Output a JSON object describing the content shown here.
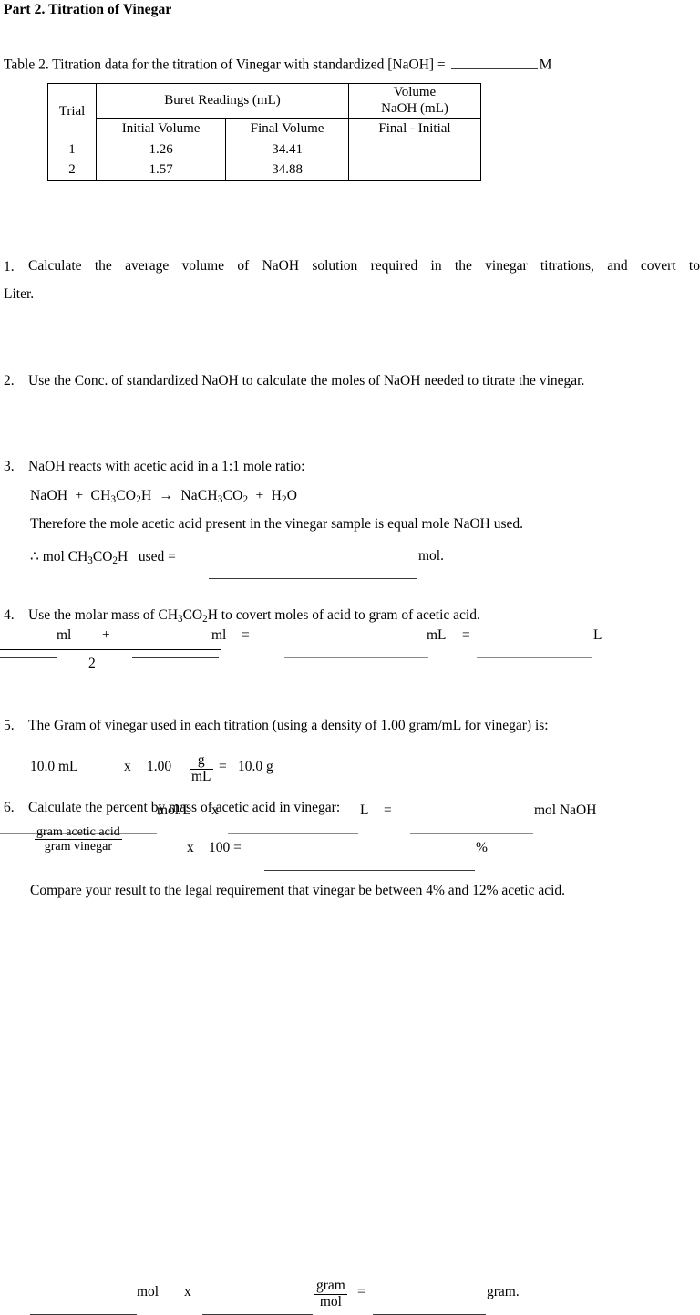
{
  "document": {
    "title": "Part 2.  Titration of Vinegar"
  },
  "table_section": {
    "caption_prefix": "Table 2.   Titration data for the titration of Vinegar with standardized [NaOH] =",
    "caption_unit": "M",
    "table": {
      "header_row": {
        "trial": "Trial",
        "buret": "Buret Readings (mL)",
        "volume_line1": "Volume",
        "volume_line2": "NaOH (mL)"
      },
      "subheader_row": {
        "trial": "",
        "initial": "Initial Volume",
        "final": "Final Volume",
        "difference": "Final - Initial"
      },
      "rows": [
        {
          "trial": "1",
          "initial": "1.26",
          "final": "34.41",
          "volume": ""
        },
        {
          "trial": "2",
          "initial": "1.57",
          "final": "34.88",
          "volume": ""
        }
      ]
    }
  },
  "questions": [
    {
      "number": "1.",
      "text_line1": "Calculate the average volume of NaOH solution required in the vinegar titrations, and covert to",
      "text_line2": "Liter.",
      "work": {
        "unit_ml_1": "ml",
        "plus": "+",
        "unit_ml_2": "ml",
        "equals_1": "=",
        "unit_mL": "mL",
        "equals_2": "=",
        "unit_L": "L",
        "denominator": "2"
      }
    },
    {
      "number": "2.",
      "text_line1": "Use the Conc. of standardized NaOH to calculate the moles of NaOH needed to titrate the vinegar.",
      "work": {
        "unit_molL": "mol/L",
        "times": "x",
        "unit_L": "L",
        "equals": "=",
        "unit_mol_naoh": "mol NaOH"
      }
    },
    {
      "number": "3.",
      "text_line1": "NaOH reacts with acetic acid in a 1:1 mole ratio:",
      "equation": {
        "reactant_1": "NaOH",
        "plus_1": "+",
        "reactant_2_pre": "CH",
        "reactant_2_sub1": "3",
        "reactant_2_mid": "CO",
        "reactant_2_sub2": "2",
        "reactant_2_post": "H",
        "arrow": "→",
        "product_1_pre": "NaCH",
        "product_1_sub1": "3",
        "product_1_mid": "CO",
        "product_1_sub2": "2",
        "plus_2": "+",
        "product_2_pre": "H",
        "product_2_sub": "2",
        "product_2_post": "O"
      },
      "note": "Therefore the mole acetic acid present in the vinegar sample is equal mole NaOH used.",
      "work": {
        "therefore_symbol": "∴",
        "label_pre": "mol CH",
        "label_sub1": "3",
        "label_mid": "CO",
        "label_sub2": "2",
        "label_post": "H",
        "used_equals": "used =",
        "unit_mol": "mol."
      }
    },
    {
      "number": "4.",
      "text_pre": "Use the molar mass of CH",
      "text_sub1": "3",
      "text_mid": "CO",
      "text_sub2": "2",
      "text_post": "H to covert moles of acid to gram of acetic acid.",
      "work": {
        "unit_mol": "mol",
        "times": "x",
        "frac_num": "gram",
        "frac_den": "mol",
        "equals": "=",
        "unit_gram": "gram."
      }
    },
    {
      "number": "5.",
      "text_line1": "The Gram of vinegar used in each titration (using a density of 1.00 gram/mL for vinegar) is:",
      "work": {
        "volume": "10.0 mL",
        "times": "x",
        "density": "1.00",
        "frac_num": "g",
        "frac_den": "mL",
        "equals": "=",
        "result": "10.0 g"
      }
    },
    {
      "number": "6.",
      "text_line1": "Calculate the percent by mass of acetic acid in vinegar:",
      "work": {
        "frac_num": "gram acetic acid",
        "frac_den": "gram vinegar",
        "times": "x",
        "hundred": "100 =",
        "percent": "%"
      },
      "compare": "Compare your result to the legal requirement that vinegar be between 4% and 12% acetic acid."
    }
  ]
}
